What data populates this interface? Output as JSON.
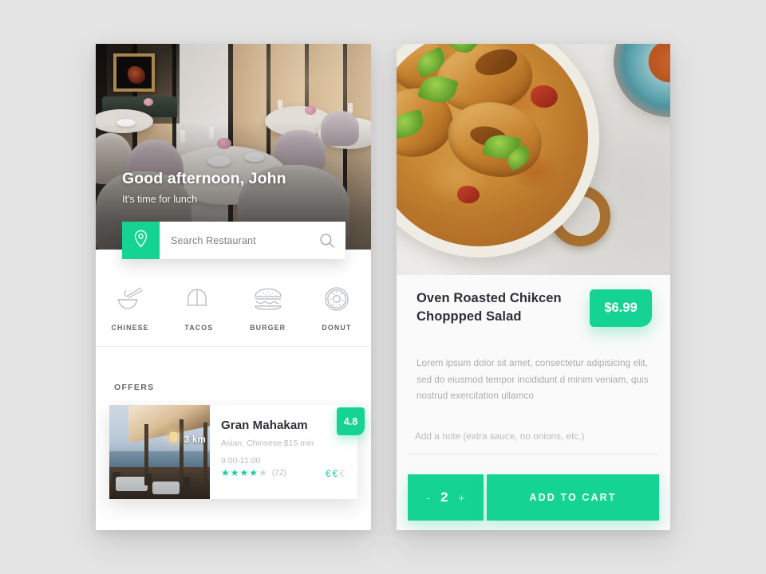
{
  "theme": {
    "accent": "#15d392",
    "page_background": "#e4e4e4",
    "card_background": "#ffffff",
    "detail_card_background": "#fafafa",
    "title_color": "#2c2f36",
    "muted_color": "#a9acb3"
  },
  "home_screen": {
    "hero": {
      "greeting": "Good afternoon, John",
      "subtitle": "It's time for lunch",
      "image_alt": "restaurant-interior-photo"
    },
    "search": {
      "placeholder": "Search Restaurant",
      "pin_icon": "location-pin-icon",
      "search_icon": "search-icon"
    },
    "categories": [
      {
        "label": "CHINESE",
        "icon": "noodle-bowl-icon"
      },
      {
        "label": "TACOS",
        "icon": "taco-icon"
      },
      {
        "label": "BURGER",
        "icon": "burger-icon"
      },
      {
        "label": "DONUT",
        "icon": "donut-icon"
      }
    ],
    "offers": {
      "section_label": "OFFERS",
      "items": [
        {
          "name": "Gran Mahakam",
          "cuisine": "Asian, Chinsese $15 min",
          "hours": "9:00-11:00",
          "distance": "3 km",
          "score": "4.8",
          "stars_filled": 4,
          "stars_total": 5,
          "review_count": "(72)",
          "price_level_filled": 2,
          "price_level_total": 3,
          "price_symbol": "€",
          "image_alt": "beachside-restaurant-photo"
        }
      ]
    }
  },
  "detail_screen": {
    "image_alt": "curry-chicken-pan-photo",
    "title": "Oven Roasted Chikcen Choppped Salad",
    "price": "$6.99",
    "description": "Lorem ipsum dolor sit amet, consectetur adipisicing elit, sed do eiusmod tempor incididunt d minim veniam, quis nostrud exercitation ullamco",
    "note": {
      "value": "",
      "placeholder": "Add a note (extra sauce, no onions, etc.)"
    },
    "quantity": {
      "minus_label": "-",
      "value": "2",
      "plus_label": "+"
    },
    "add_to_cart_label": "ADD TO CART"
  }
}
